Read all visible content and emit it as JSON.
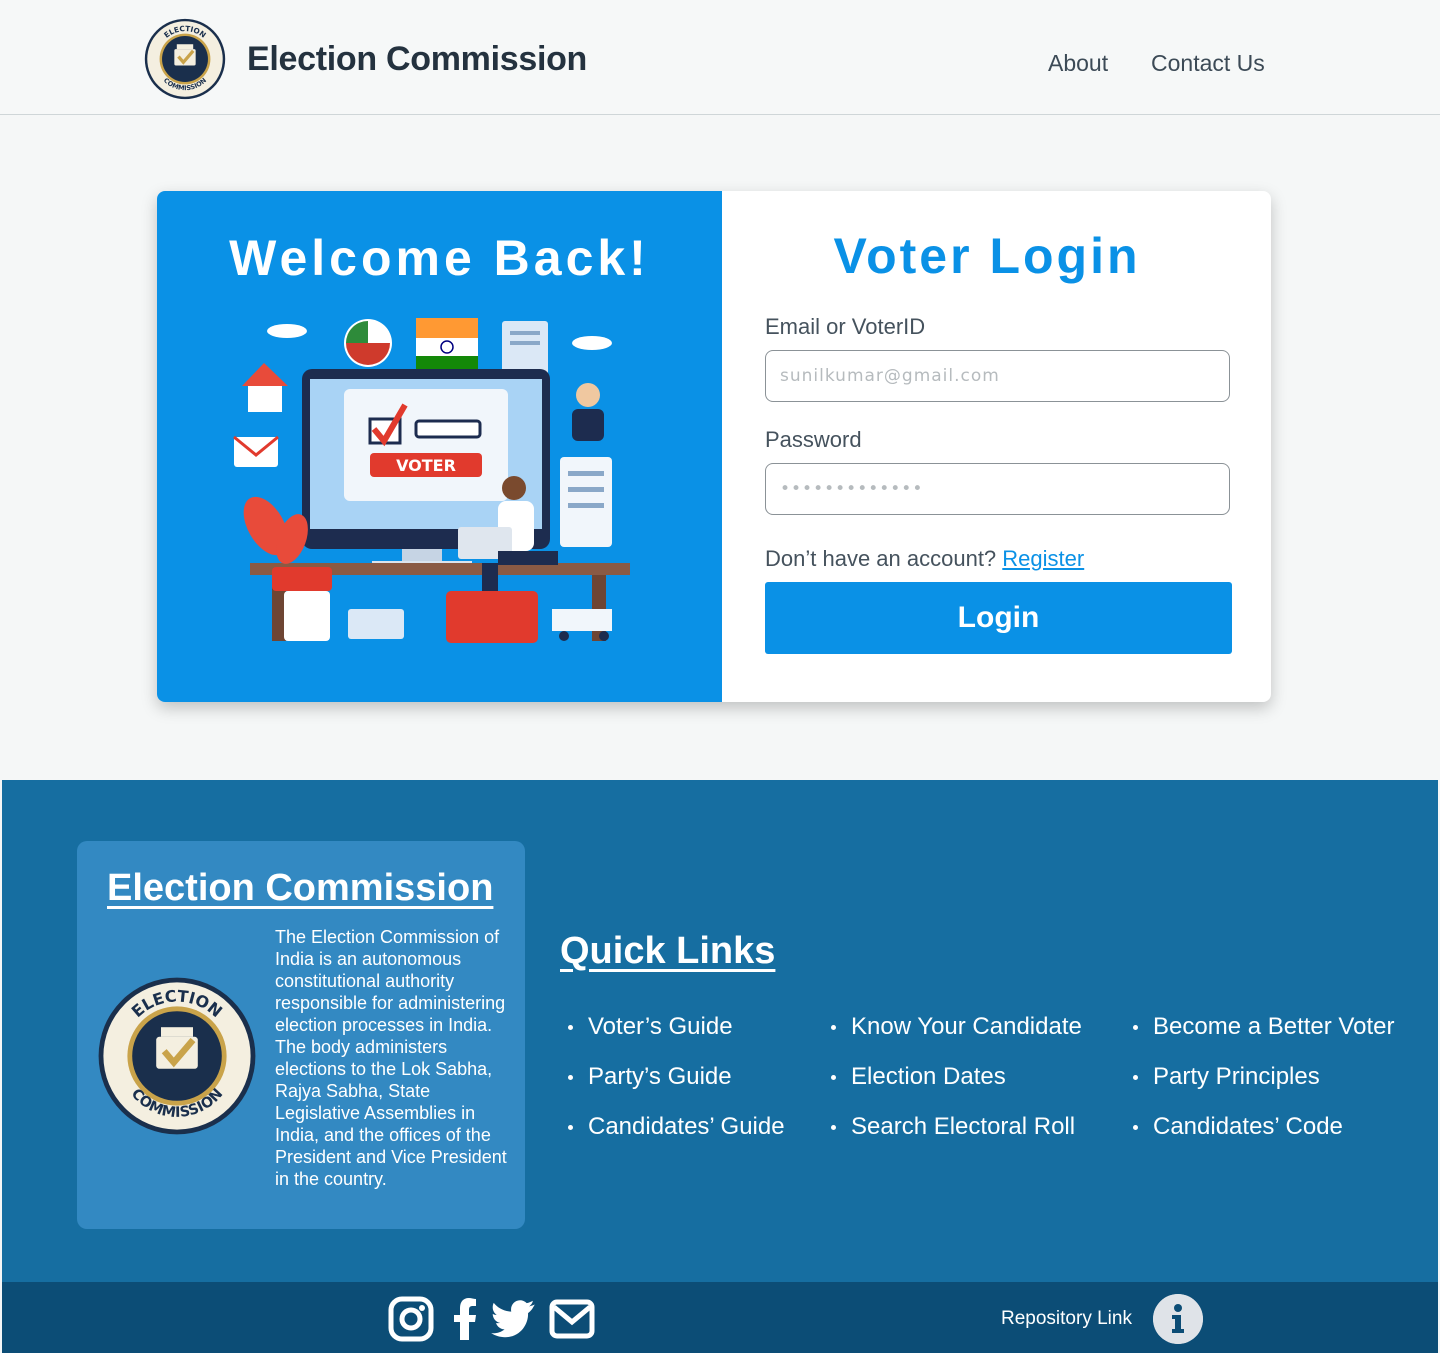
{
  "header": {
    "brand": "Election Commission",
    "nav": [
      {
        "label": "About"
      },
      {
        "label": "Contact Us"
      }
    ]
  },
  "login_card": {
    "welcome": "Welcome Back!",
    "illustration_text": "VOTER",
    "title": "Voter Login",
    "email_label": "Email or VoterID",
    "email_placeholder": "sunilkumar@gmail.com",
    "password_label": "Password",
    "password_value": "•••••••••••••",
    "no_account_text": "Don’t have an account?",
    "register_link": "Register",
    "login_button": "Login"
  },
  "logo_text": {
    "top": "ELECTION",
    "bottom": "COMMISSION"
  },
  "footer": {
    "about_title": "Election Commission",
    "about_text": "The Election Commission of India is an autonomous constitutional authority responsible for administering election processes in India. The body administers elections to the Lok Sabha, Rajya Sabha, State Legislative Assemblies in India, and the offices of the President and Vice President in the country.",
    "quick_links_title": "Quick Links",
    "quick_links": [
      [
        "Voter’s Guide",
        "Party’s Guide",
        "Candidates’ Guide"
      ],
      [
        "Know Your Candidate",
        "Election Dates",
        "Search Electoral Roll"
      ],
      [
        "Become a Better Voter",
        "Party Principles",
        "Candidates’ Code"
      ]
    ],
    "social_icons": [
      "instagram-icon",
      "facebook-icon",
      "twitter-icon",
      "email-icon"
    ],
    "repo_link": "Repository Link"
  },
  "colors": {
    "primary": "#0a91e6",
    "footer_bg": "#166ea1",
    "footer_box": "#3389c2",
    "bottom_bar": "#0c4d76",
    "page_bg": "#f5f7f7"
  }
}
